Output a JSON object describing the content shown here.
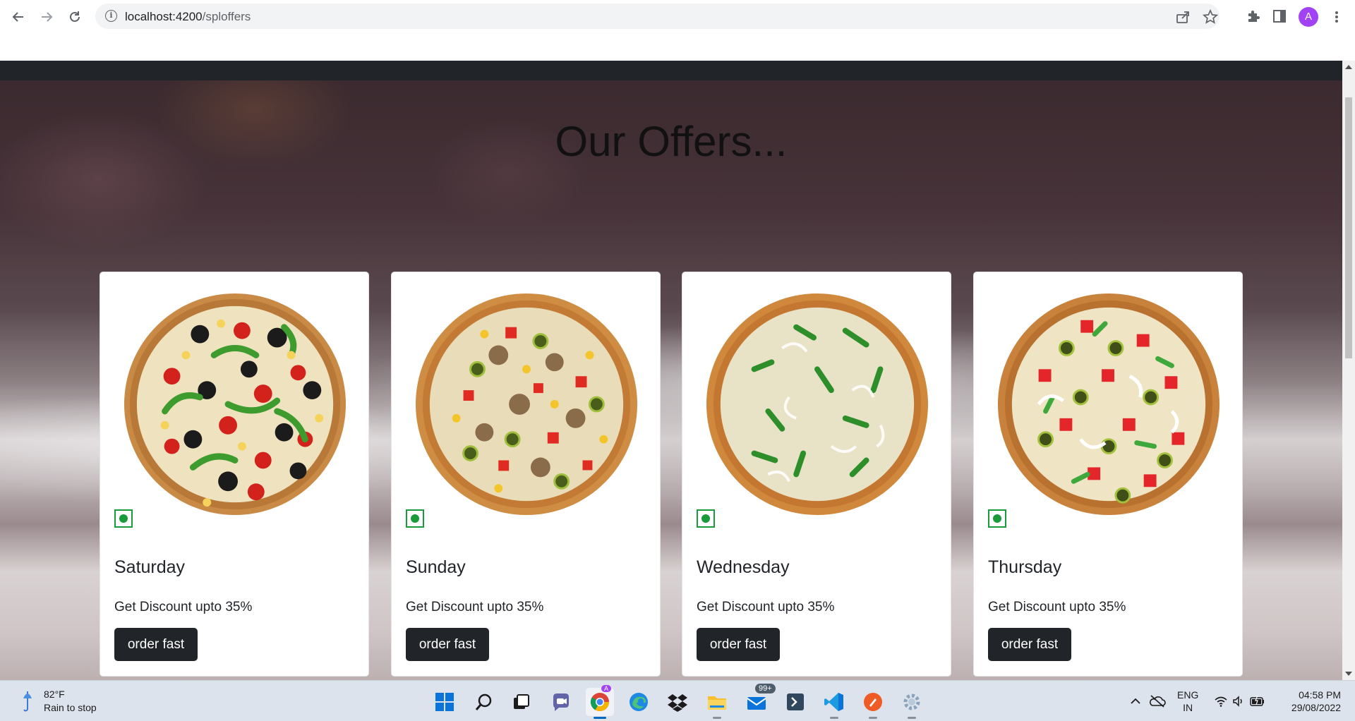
{
  "browser": {
    "url_host": "localhost:4200",
    "url_path": "/sploffers",
    "profile_initial": "A"
  },
  "page": {
    "title": "Our Offers..."
  },
  "offers": [
    {
      "day": "Saturday",
      "text": "Get Discount upto 35%",
      "button": "order fast",
      "toppings": "olives-peppers-tomato-corn"
    },
    {
      "day": "Sunday",
      "text": "Get Discount upto 35%",
      "button": "order fast",
      "toppings": "mushroom-jalapeno-corn-paprika"
    },
    {
      "day": "Wednesday",
      "text": "Get Discount upto 35%",
      "button": "order fast",
      "toppings": "capsicum-onion"
    },
    {
      "day": "Thursday",
      "text": "Get Discount upto 35%",
      "button": "order fast",
      "toppings": "paprika-jalapeno-onion-capsicum"
    }
  ],
  "taskbar": {
    "temperature": "82°F",
    "weather": "Rain to stop",
    "mail_badge": "99+",
    "lang_line1": "ENG",
    "lang_line2": "IN",
    "time": "04:58 PM",
    "date": "29/08/2022"
  },
  "colors": {
    "navbar": "#212529",
    "button": "#212529",
    "veg_mark": "#1a9a3a"
  }
}
